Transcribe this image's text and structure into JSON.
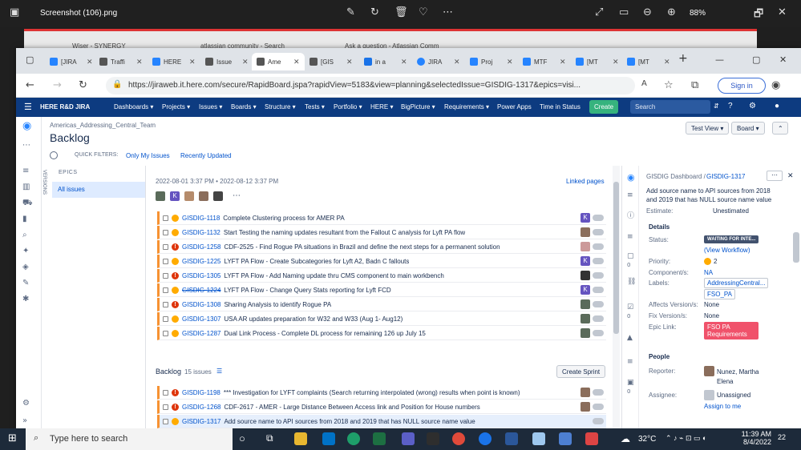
{
  "viewer": {
    "filename": "Screenshot (106).png",
    "zoom": "88%"
  },
  "bg_tabs": [
    "Wiser - SYNERGY",
    "atlassian community - Search",
    "Ask a question - Atlassian Comm"
  ],
  "browser": {
    "tabs": [
      {
        "label": "[JIRA"
      },
      {
        "label": "Traffi"
      },
      {
        "label": "HERE"
      },
      {
        "label": "Issue"
      },
      {
        "label": "Ame"
      },
      {
        "label": "[GIS"
      },
      {
        "label": "in a"
      },
      {
        "label": "JIRA"
      },
      {
        "label": "Proj"
      },
      {
        "label": "MTF"
      },
      {
        "label": "[MT"
      },
      {
        "label": "[MT"
      }
    ],
    "url": "https://jiraweb.it.here.com/secure/RapidBoard.jspa?rapidView=5183&view=planning&selectedIssue=GISDIG-1317&epics=visi...",
    "signin": "Sign in"
  },
  "jira_nav": {
    "brand": "HERE R&D JIRA",
    "items": [
      "Dashboards ▾",
      "Projects ▾",
      "Issues ▾",
      "Boards ▾",
      "Structure ▾",
      "Tests ▾",
      "Portfolio ▾",
      "HERE ▾",
      "BigPicture ▾",
      "Requirements ▾",
      "Power Apps",
      "Time in Status"
    ],
    "create": "Create",
    "search_placeholder": "Search"
  },
  "page": {
    "breadcrumb": "Americas_Addressing_Central_Team",
    "title": "Backlog",
    "quick_filters_label": "QUICK FILTERS:",
    "filters": [
      "Only My Issues",
      "Recently Updated"
    ],
    "test_view": "Test View ▾",
    "board": "Board ▾"
  },
  "left_panel": {
    "versions": "VERSIONS",
    "epics": "EPICS",
    "all_issues": "All issues"
  },
  "sprint": {
    "dates": "2022-08-01 3:37 PM  •  2022-08-12 3:37 PM",
    "linked_pages": "Linked pages"
  },
  "sprint_issues": [
    {
      "key": "GISDIG-1118",
      "summary": "Complete Clustering process for AMER PA",
      "priority": "med",
      "assignee": "K"
    },
    {
      "key": "GISDIG-1132",
      "summary": "Start Testing the naming updates resultant from the Fallout C analysis for Lyft PA flow",
      "priority": "med",
      "assignee": ""
    },
    {
      "key": "GISDIG-1258",
      "summary": "CDF-2525 - Find Rogue PA situations in Brazil and define the next steps for a permanent solution",
      "priority": "high",
      "assignee": ""
    },
    {
      "key": "GISDIG-1225",
      "summary": "LYFT PA Flow - Create Subcategories for Lyft A2, Badn C fallouts",
      "priority": "med",
      "assignee": "K"
    },
    {
      "key": "GISDIG-1305",
      "summary": "LYFT PA Flow - Add Naming update thru CMS component to main workbench",
      "priority": "high",
      "assignee": ""
    },
    {
      "key": "GISDIG-1224",
      "summary": "LYFT PA Flow - Change Query Stats reporting for Lyft FCD",
      "priority": "med",
      "assignee": "K",
      "strike": true
    },
    {
      "key": "GISDIG-1308",
      "summary": "Sharing Analysis to identify Rogue PA",
      "priority": "high",
      "assignee": ""
    },
    {
      "key": "GISDIG-1307",
      "summary": "USA AR updates preparation for W32 and W33 (Aug 1- Aug12)",
      "priority": "med",
      "assignee": ""
    },
    {
      "key": "GISDIG-1287",
      "summary": "Dual Link Process - Complete DL process for remaining 126 up July 15",
      "priority": "med",
      "assignee": ""
    }
  ],
  "backlog": {
    "title": "Backlog",
    "count": "15 issues",
    "create_sprint": "Create Sprint"
  },
  "backlog_issues": [
    {
      "key": "GISDIG-1198",
      "summary": "*** Investigation for LYFT complaints (Search returning interpolated (wrong) results when point is known)",
      "priority": "high"
    },
    {
      "key": "GISDIG-1268",
      "summary": "CDF-2617 - AMER - Large Distance Between Access link and Position for House numbers",
      "priority": "high"
    },
    {
      "key": "GISDIG-1317",
      "summary": "Add source name to API sources from 2018 and 2019 that has NULL source name value",
      "priority": "med"
    }
  ],
  "detail": {
    "crumb_project": "GISDIG Dashboard /",
    "crumb_key": "GISDIG-1317",
    "title": "Add source name to API sources from 2018 and 2019 that has NULL source name value",
    "estimate_label": "Estimate:",
    "estimate_value": "Unestimated",
    "details_header": "Details",
    "status_label": "Status:",
    "status_value": "WAITING FOR INTE...",
    "view_workflow": "(View Workflow)",
    "priority_label": "Priority:",
    "priority_value": "2",
    "component_label": "Component/s:",
    "component_value": "NA",
    "labels_label": "Labels:",
    "labels": [
      "AddressingCentral...",
      "FSO_PA"
    ],
    "affects_label": "Affects Version/s:",
    "affects_value": "None",
    "fix_label": "Fix Version/s:",
    "fix_value": "None",
    "epic_label": "Epic Link:",
    "epic_value": "FSO PA Requirements",
    "people_header": "People",
    "reporter_label": "Reporter:",
    "reporter_value": "Nunez, Martha Elena",
    "assignee_label": "Assignee:",
    "assignee_value": "Unassigned",
    "assign_me": "Assign to me",
    "side_counts": [
      "0",
      "0",
      "0"
    ]
  },
  "taskbar": {
    "search": "Type here to search",
    "weather": "32°C",
    "time": "11:39 AM",
    "date": "8/4/2022",
    "notif": "22"
  }
}
